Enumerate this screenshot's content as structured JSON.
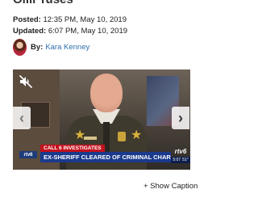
{
  "article": {
    "cut_title": "Olili Tuses",
    "posted_label": "Posted:",
    "posted_value": "12:35 PM, May 10, 2019",
    "updated_label": "Updated:",
    "updated_value": "6:07 PM, May 10, 2019",
    "by_label": "By:",
    "author": "Kara Kenney"
  },
  "video": {
    "mute_icon": "speaker-muted-icon",
    "prev_icon": "chevron-left-icon",
    "next_icon": "chevron-right-icon",
    "prev_glyph": "‹",
    "next_glyph": "›",
    "lower_third": {
      "left_logo": "rtv6",
      "tag": "CALL 6 INVESTIGATES",
      "headline": "EX-SHERIFF CLEARED OF CRIMINAL CHARGES",
      "right_logo": "rtv6",
      "time": "5:07",
      "temp": "51°"
    }
  },
  "caption": {
    "toggle_label": "+ Show Caption"
  },
  "colors": {
    "link": "#2f6fb0",
    "tag_red": "#c3111c",
    "headline_blue": "#1a3a8c"
  }
}
